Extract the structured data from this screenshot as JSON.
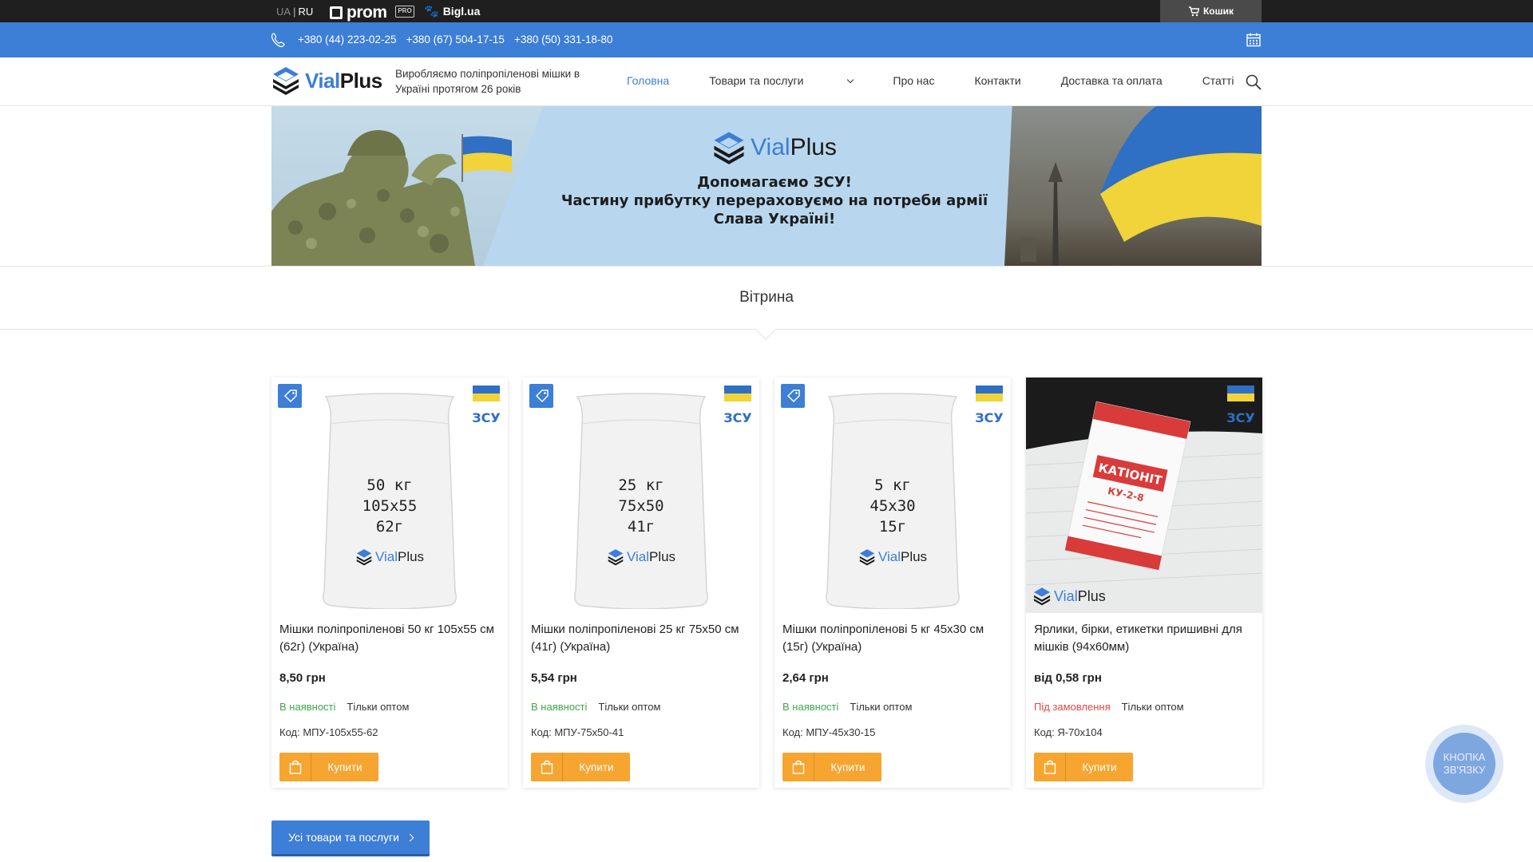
{
  "topbar": {
    "lang_ua": "UA",
    "lang_ru": "RU",
    "prom": "prom",
    "prom_pro": "PRO",
    "bigl": "Bigl.ua",
    "cart": "Кошик"
  },
  "phonebar": {
    "phones": [
      "+380 (44) 223-02-25",
      "+380 (67) 504-17-15",
      "+380 (50) 331-18-80"
    ]
  },
  "header": {
    "logo_v": "Vial",
    "logo_plus": "Plus",
    "tagline": "Виробляємо поліпропіленові мішки в Україні протягом 26 років",
    "nav": [
      "Головна",
      "Товари та послуги",
      "Про нас",
      "Контакти",
      "Доставка та оплата",
      "Статті"
    ]
  },
  "banner": {
    "logo_v": "Vial",
    "logo_plus": "Plus",
    "line1": "Допомагаємо ЗСУ!",
    "line2": "Частину прибутку перераховуємо на потреби армії",
    "line3": "Слава Україні!"
  },
  "section": {
    "title": "Вітрина"
  },
  "products": [
    {
      "sack_lines": [
        "50 кг",
        "105x55",
        "62г"
      ],
      "title": "Мішки поліпропіленові 50 кг 105х55 см (62г) (Україна)",
      "price": "8,50 грн",
      "availability": "В наявності",
      "wholesale": "Тільки оптом",
      "code": "Код: МПУ-105х55-62",
      "buy": "Купити"
    },
    {
      "sack_lines": [
        "25 кг",
        "75x50",
        "41г"
      ],
      "title": "Мішки поліпропіленові 25 кг 75х50 см (41г) (Україна)",
      "price": "5,54 грн",
      "availability": "В наявності",
      "wholesale": "Тільки оптом",
      "code": "Код: МПУ-75х50-41",
      "buy": "Купити"
    },
    {
      "sack_lines": [
        "5 кг",
        "45x30",
        "15г"
      ],
      "title": "Мішки поліпропіленові 5 кг 45х30 см (15г) (Україна)",
      "price": "2,64 грн",
      "availability": "В наявності",
      "wholesale": "Тільки оптом",
      "code": "Код: МПУ-45х30-15",
      "buy": "Купити"
    },
    {
      "title": "Ярлики, бірки, етикетки пришивні для мішків (94х60мм)",
      "price": "від 0,58 грн",
      "availability": "Під замовлення",
      "wholesale": "Тільки оптом",
      "code": "Код: Я-70х104",
      "buy": "Купити",
      "label_text": "КАТІОНІТ",
      "label_sub": "КУ-2-8"
    }
  ],
  "zsu_label": "ЗСУ",
  "sack_logo_v": "Vial",
  "sack_logo_plus": "Plus",
  "all_products": "Усі товари та послуги",
  "contact": {
    "line1": "КНОПКА",
    "line2": "ЗВ'ЯЗКУ"
  },
  "colors": {
    "accent": "#3d7ed6",
    "buy": "#f6a530",
    "in_stock": "#3ea84a",
    "on_order": "#e04848"
  }
}
